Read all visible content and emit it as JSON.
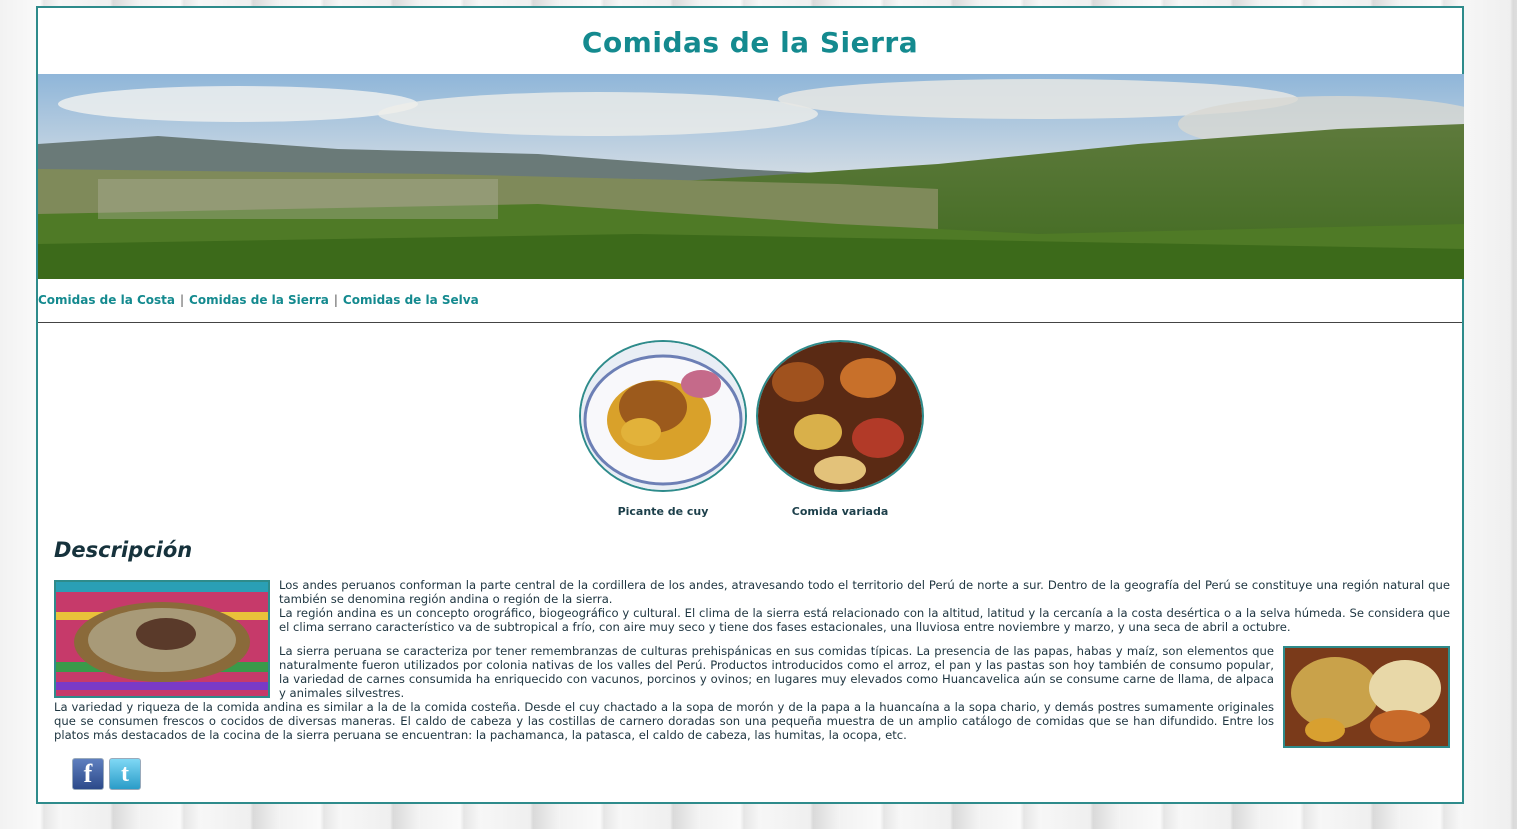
{
  "header": {
    "title": "Comidas de la Sierra"
  },
  "nav": {
    "items": [
      "Comidas de la Costa",
      "Comidas de la Sierra",
      "Comidas de la Selva"
    ],
    "separator": "|"
  },
  "gallery": [
    {
      "caption": "Picante de cuy"
    },
    {
      "caption": "Comida variada"
    }
  ],
  "description": {
    "heading": "Descripción",
    "p1": "Los andes peruanos conforman la parte central de la cordillera de los andes, atravesando todo el territorio del Perú de norte a sur. Dentro de la geografía del Perú se constituye una región natural que también se denomina región andina o región de la sierra.",
    "p2": "La región andina es un concepto orográfico, biogeográfico y cultural. El clima de la sierra está relacionado con la altitud, latitud y la cercanía a la costa desértica o a la selva húmeda. Se considera que el clima serrano característico va de subtropical a frío, con aire muy seco y tiene dos fases estacionales, una lluviosa entre noviembre y marzo, y una seca de abril a octubre.",
    "p3": "La sierra peruana se caracteriza por tener remembranzas de culturas prehispánicas en sus comidas típicas. La presencia de las papas, habas y maíz, son elementos que naturalmente fueron utilizados por colonia nativas de los valles del Perú. Productos introducidos como el arroz, el pan y las pastas son hoy también de consumo popular, la variedad de carnes consumida ha enriquecido con vacunos, porcinos y ovinos; en lugares muy elevados como Huancavelica aún se consume carne de llama, de alpaca y animales silvestres.",
    "p4": "La variedad y riqueza de la comida andina es similar a la de la comida costeña. Desde el cuy chactado a la sopa de morón y de la papa a la huancaína a la sopa chario, y demás postres sumamente originales que se consumen frescos o cocidos de diversas maneras. El caldo de cabeza y las costillas de carnero doradas son una pequeña muestra de un amplio catálogo de comidas que se han difundido. Entre los platos más destacados de la cocina de la sierra peruana se encuentran: la pachamanca, la patasca, el caldo de cabeza, las humitas, la ocopa, etc."
  },
  "social": {
    "facebook_glyph": "f",
    "twitter_glyph": "t"
  },
  "colors": {
    "accent": "#148a8f",
    "border": "#2e8b8b",
    "heading": "#16323c"
  }
}
